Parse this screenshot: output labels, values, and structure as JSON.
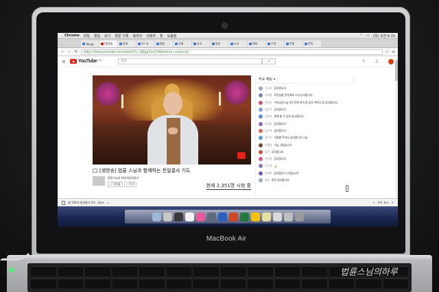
{
  "device": {
    "brand": "MacBook Air",
    "watermark": "법륜스님의하루"
  },
  "menubar": {
    "app_name": "Chrome",
    "items": [
      "파일",
      "편집",
      "보기",
      "방문 기록",
      "북마크",
      "사용자",
      "창",
      "도움말"
    ],
    "status": "(목) 오전 6:15"
  },
  "browser": {
    "tabs": [
      {
        "label": "Telegr"
      },
      {
        "label": "[생방송"
      },
      {
        "label": "휴대"
      },
      {
        "label": "(1) 유"
      },
      {
        "label": "법륜"
      },
      {
        "label": "국제"
      },
      {
        "label": "삼국"
      },
      {
        "label": "법륜"
      },
      {
        "label": "뉴키"
      },
      {
        "label": "해외"
      },
      {
        "label": "수일"
      },
      {
        "label": "복합"
      },
      {
        "label": "문화"
      }
    ],
    "url": "https://www.youtube.com/watch?v=5JEgp1ax5YI&feature=youtu.be"
  },
  "youtube": {
    "logo_text": "YouTube",
    "logo_region": "KR",
    "search_placeholder": "검색",
    "video_title": "[생방송] 법륜 스님과 함께하는 천일결사 기도",
    "channel_name": "법륜스님의 희망세상만들기",
    "subscribe_label": "구독중",
    "subscriber_count": "55천",
    "viewers": "현재 2,351명 시청 중"
  },
  "chat": {
    "header": "주요 채팅",
    "messages": [
      {
        "author": "신시유",
        "text": "감사합니다.",
        "color": "#9aa7b8"
      },
      {
        "author": "조호원",
        "text": "도반님들 반가워요 스님 감사합니다.",
        "color": "#6d8bb3"
      },
      {
        "author": "안지유",
        "text": "우리님모스님 운수건에 저녁 음 감사 기쁘고 참 감사합니다.",
        "color": "#c45a7a"
      },
      {
        "author": "김진이",
        "text": "감사합니다",
        "color": "#7aa3d6"
      },
      {
        "author": "김한지",
        "text": "함께 할 수 있어 감사합니다",
        "color": "#5b8ed6"
      },
      {
        "author": "진미성",
        "text": "감사합니다",
        "color": "#8e6ab3"
      },
      {
        "author": "김은희",
        "text": "감사합니다",
        "color": "#d36a5a"
      },
      {
        "author": "정우주",
        "text": "기회를 주셔서 감사합니다 스님",
        "color": "#5a9ad6"
      },
      {
        "author": "이종원",
        "text": "스님 고맙습니다",
        "color": "#6a4a3a"
      },
      {
        "author": "김진",
        "text": "감사합니다",
        "color": "#c8553d"
      },
      {
        "author": "윤성희",
        "text": "감사합니다",
        "color": "#d65a8a"
      },
      {
        "author": "무구심",
        "text": "🙏",
        "color": "#8a7ab3"
      },
      {
        "author": "정세미",
        "text": "감사합니다 고맙습니다",
        "color": "#7a5ab8"
      },
      {
        "author": "정희",
        "text": "천강 감사합니다",
        "color": "#9aa7b8"
      }
    ]
  },
  "downloads": {
    "file_name": "제 100차 천일결사 2차...docx",
    "show_all": "모두 표시"
  },
  "colors": {
    "youtube_red": "#e62117",
    "desktop_blue": "#1d2a55"
  }
}
